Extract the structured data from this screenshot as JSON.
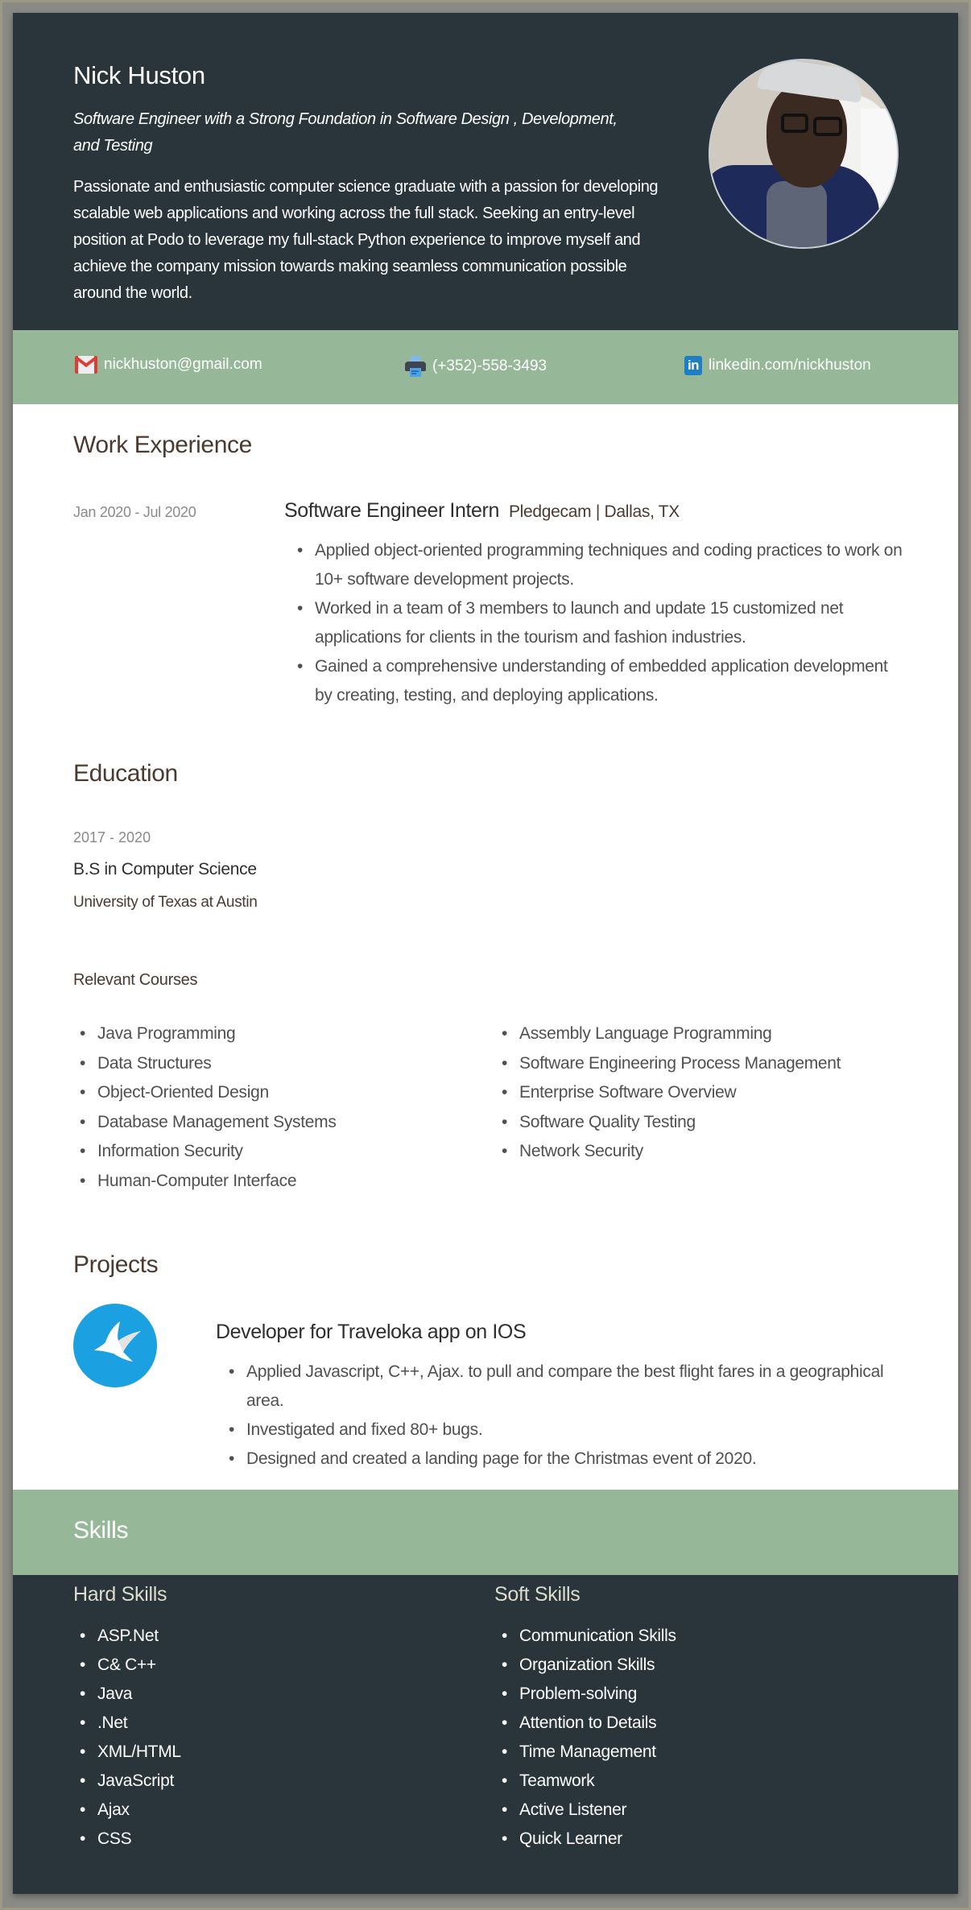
{
  "header": {
    "name": "Nick Huston",
    "tagline": "Software Engineer with a Strong Foundation in Software Design , Development, and Testing",
    "summary": "Passionate and enthusiastic computer science graduate with a passion for developing scalable web applications and working across the full stack. Seeking an entry-level position at Podo to leverage my full-stack Python experience to improve myself and achieve the company mission towards making seamless communication possible around the world.",
    "photo_alt": "portrait-photo"
  },
  "contact": {
    "email": {
      "icon": "gmail-icon",
      "text": "nickhuston@gmail.com"
    },
    "phone": {
      "icon": "printer-icon",
      "text": "(+352)-558-3493"
    },
    "linkedin": {
      "icon": "linkedin-icon",
      "glyph": "in",
      "text": "linkedin.com/nickhuston"
    }
  },
  "work": {
    "title": "Work Experience",
    "jobs": [
      {
        "dates": "Jan 2020 - Jul 2020",
        "position": "Software Engineer Intern",
        "company": "Pledgecam | Dallas, TX",
        "bullets": [
          "Applied object-oriented programming techniques and coding practices to work on 10+ software development projects.",
          "Worked in a team of 3 members to launch and update 15 customized net applications for clients in the tourism and fashion industries.",
          "Gained a comprehensive understanding of embedded application development by creating, testing, and deploying applications."
        ]
      }
    ]
  },
  "education": {
    "title": "Education",
    "dates": "2017 - 2020",
    "degree": "B.S in Computer Science",
    "school": "University of Texas at Austin",
    "courses_title": "Relevant Courses",
    "courses_left": [
      "Java Programming",
      "Data Structures",
      "Object-Oriented Design",
      "Database Management Systems",
      "Information Security",
      "Human-Computer Interface"
    ],
    "courses_right": [
      "Assembly Language Programming",
      "Software Engineering Process Management",
      "Enterprise Software Overview",
      "Software Quality Testing",
      "Network Security"
    ]
  },
  "projects": {
    "title": "Projects",
    "items": [
      {
        "logo_icon": "traveloka-bird-icon",
        "title": "Developer for Traveloka app on IOS",
        "bullets": [
          "Applied Javascript, C++, Ajax. to pull and compare the best flight fares in a geographical area.",
          "Investigated and fixed 80+ bugs.",
          "Designed and created a landing page for the Christmas event of 2020."
        ]
      }
    ]
  },
  "skills": {
    "title": "Skills",
    "hard_title": "Hard Skills",
    "hard": [
      "ASP.Net",
      "C& C++",
      "Java",
      ".Net",
      "XML/HTML",
      "JavaScript",
      "Ajax",
      "CSS"
    ],
    "soft_title": "Soft Skills",
    "soft": [
      "Communication Skills",
      "Organization Skills",
      "Problem-solving",
      "Attention to Details",
      "Time Management",
      "Teamwork",
      "Active Listener",
      "Quick Learner"
    ]
  },
  "colors": {
    "dark": "#29353a",
    "green": "#96b899",
    "heading_brown": "#4b3a30",
    "body_text": "#505050",
    "frame_gray": "#8a8a86",
    "logo_blue": "#1ba0e2"
  }
}
